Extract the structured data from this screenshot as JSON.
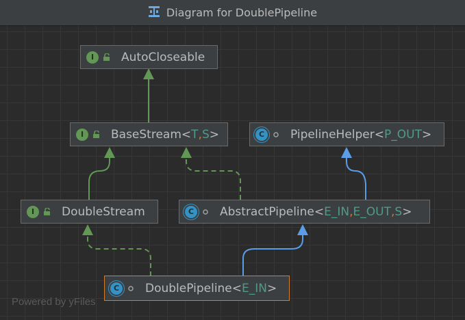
{
  "window": {
    "title": "Diagram for DoublePipeline"
  },
  "nodes": {
    "autocloseable": {
      "name": "AutoCloseable"
    },
    "basestream": {
      "name": "BaseStream",
      "params": [
        "T",
        "S"
      ]
    },
    "pipelinehelper": {
      "name": "PipelineHelper",
      "params": [
        "P_OUT"
      ]
    },
    "doublestream": {
      "name": "DoubleStream"
    },
    "abstractpipeline": {
      "name": "AbstractPipeline",
      "params": [
        "E_IN",
        "E_OUT",
        "S"
      ]
    },
    "doublepipeline": {
      "name": "DoublePipeline",
      "params": [
        "E_IN"
      ]
    }
  },
  "badges": {
    "interface": "I",
    "class": "C"
  },
  "punct": {
    "lt": "<",
    "gt": ">",
    "comma": ", "
  },
  "footer": {
    "text": "Powered by yFiles"
  },
  "colors": {
    "extends_edge": "#629755",
    "implements_edge": "#5a9ee8",
    "selected_border": "#d27f2c",
    "type_param": "#4e9c84"
  }
}
